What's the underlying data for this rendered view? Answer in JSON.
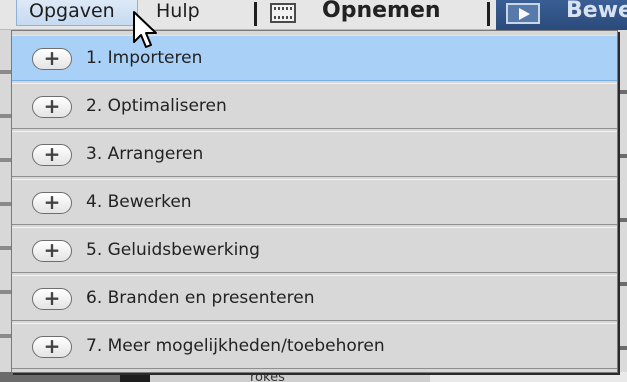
{
  "menubar": {
    "items": [
      "Opgaven",
      "Hulp"
    ]
  },
  "toolbar": {
    "record_label": "Opnemen",
    "edit_label": "Bewe"
  },
  "dropdown": {
    "items": [
      {
        "icon": "+",
        "label": "1. Importeren",
        "active": true
      },
      {
        "icon": "+",
        "label": "2. Optimaliseren"
      },
      {
        "icon": "+",
        "label": "3. Arrangeren"
      },
      {
        "icon": "+",
        "label": "4. Bewerken"
      },
      {
        "icon": "+",
        "label": "5. Geluidsbewerking"
      },
      {
        "icon": "+",
        "label": "6. Branden en presenteren"
      },
      {
        "icon": "+",
        "label": "7. Meer mogelijkheden/toebehoren"
      }
    ]
  },
  "background": {
    "partial_text": "rokes"
  },
  "colors": {
    "highlight": "#a9d1f7",
    "menu_active": "#c6daf0",
    "toolbar_blue": "#2a4a7a"
  }
}
